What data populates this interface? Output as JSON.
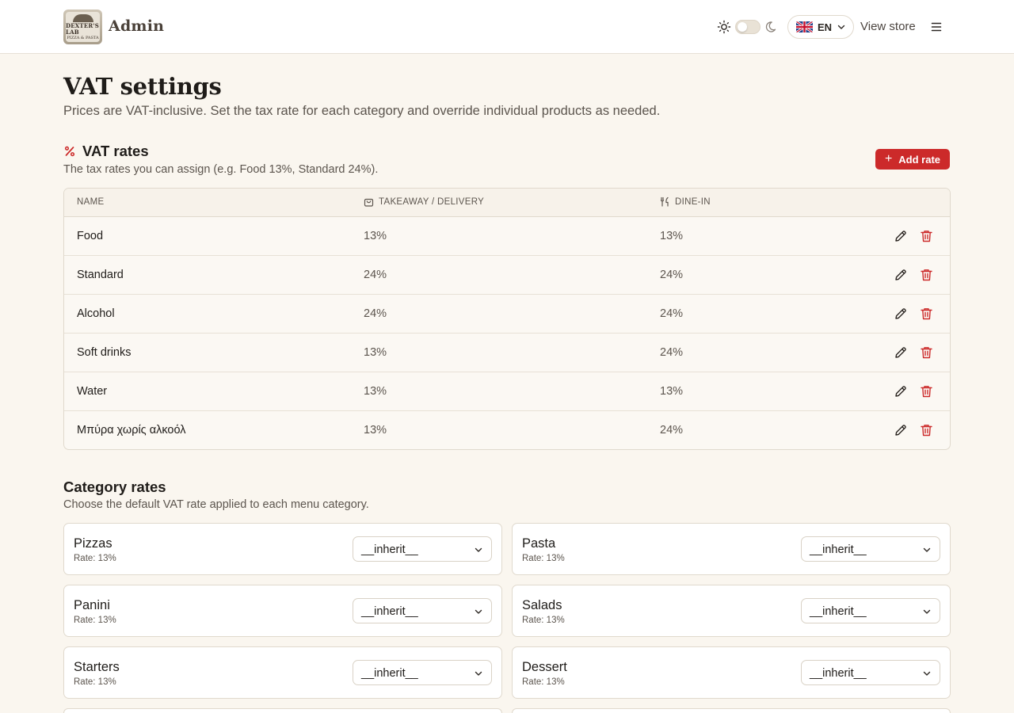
{
  "header": {
    "brand_title": "Admin",
    "logo_text": "DEXTER'S LAB",
    "logo_subtext": "PIZZA & PASTA",
    "lang_label": "EN",
    "view_store": "View store"
  },
  "page": {
    "title": "VAT settings",
    "subtitle": "Prices are VAT-inclusive. Set the tax rate for each category and override individual products as needed."
  },
  "vat_rates": {
    "title": "VAT rates",
    "subtitle": "The tax rates you can assign (e.g. Food 13%, Standard 24%).",
    "add_label": "Add rate",
    "columns": {
      "name": "NAME",
      "takeaway": "TAKEAWAY / DELIVERY",
      "dinein": "DINE-IN"
    },
    "rows": [
      {
        "name": "Food",
        "takeaway": "13%",
        "dinein": "13%"
      },
      {
        "name": "Standard",
        "takeaway": "24%",
        "dinein": "24%"
      },
      {
        "name": "Alcohol",
        "takeaway": "24%",
        "dinein": "24%"
      },
      {
        "name": "Soft drinks",
        "takeaway": "13%",
        "dinein": "24%"
      },
      {
        "name": "Water",
        "takeaway": "13%",
        "dinein": "13%"
      },
      {
        "name": "Μπύρα χωρίς αλκοόλ",
        "takeaway": "13%",
        "dinein": "24%"
      }
    ]
  },
  "category_rates": {
    "title": "Category rates",
    "subtitle": "Choose the default VAT rate applied to each menu category.",
    "items": [
      {
        "name": "Pizzas",
        "rate": "Rate: 13%",
        "selected": "__inherit__"
      },
      {
        "name": "Pasta",
        "rate": "Rate: 13%",
        "selected": "__inherit__"
      },
      {
        "name": "Panini",
        "rate": "Rate: 13%",
        "selected": "__inherit__"
      },
      {
        "name": "Salads",
        "rate": "Rate: 13%",
        "selected": "__inherit__"
      },
      {
        "name": "Starters",
        "rate": "Rate: 13%",
        "selected": "__inherit__"
      },
      {
        "name": "Dessert",
        "rate": "Rate: 13%",
        "selected": "__inherit__"
      }
    ]
  },
  "colors": {
    "accent": "#cc2a2a",
    "background": "#faf6ef",
    "surface": "#ffffff",
    "border": "#e0d9cd"
  },
  "icons": {
    "theme_light": "sun-icon",
    "theme_dark": "moon-icon",
    "flag": "uk-flag-icon",
    "menu": "hamburger-menu-icon",
    "section": "percent-icon",
    "takeaway": "shopping-bag-icon",
    "dinein": "fork-knife-icon",
    "edit": "pencil-icon",
    "delete": "trash-icon",
    "add": "plus-icon"
  }
}
